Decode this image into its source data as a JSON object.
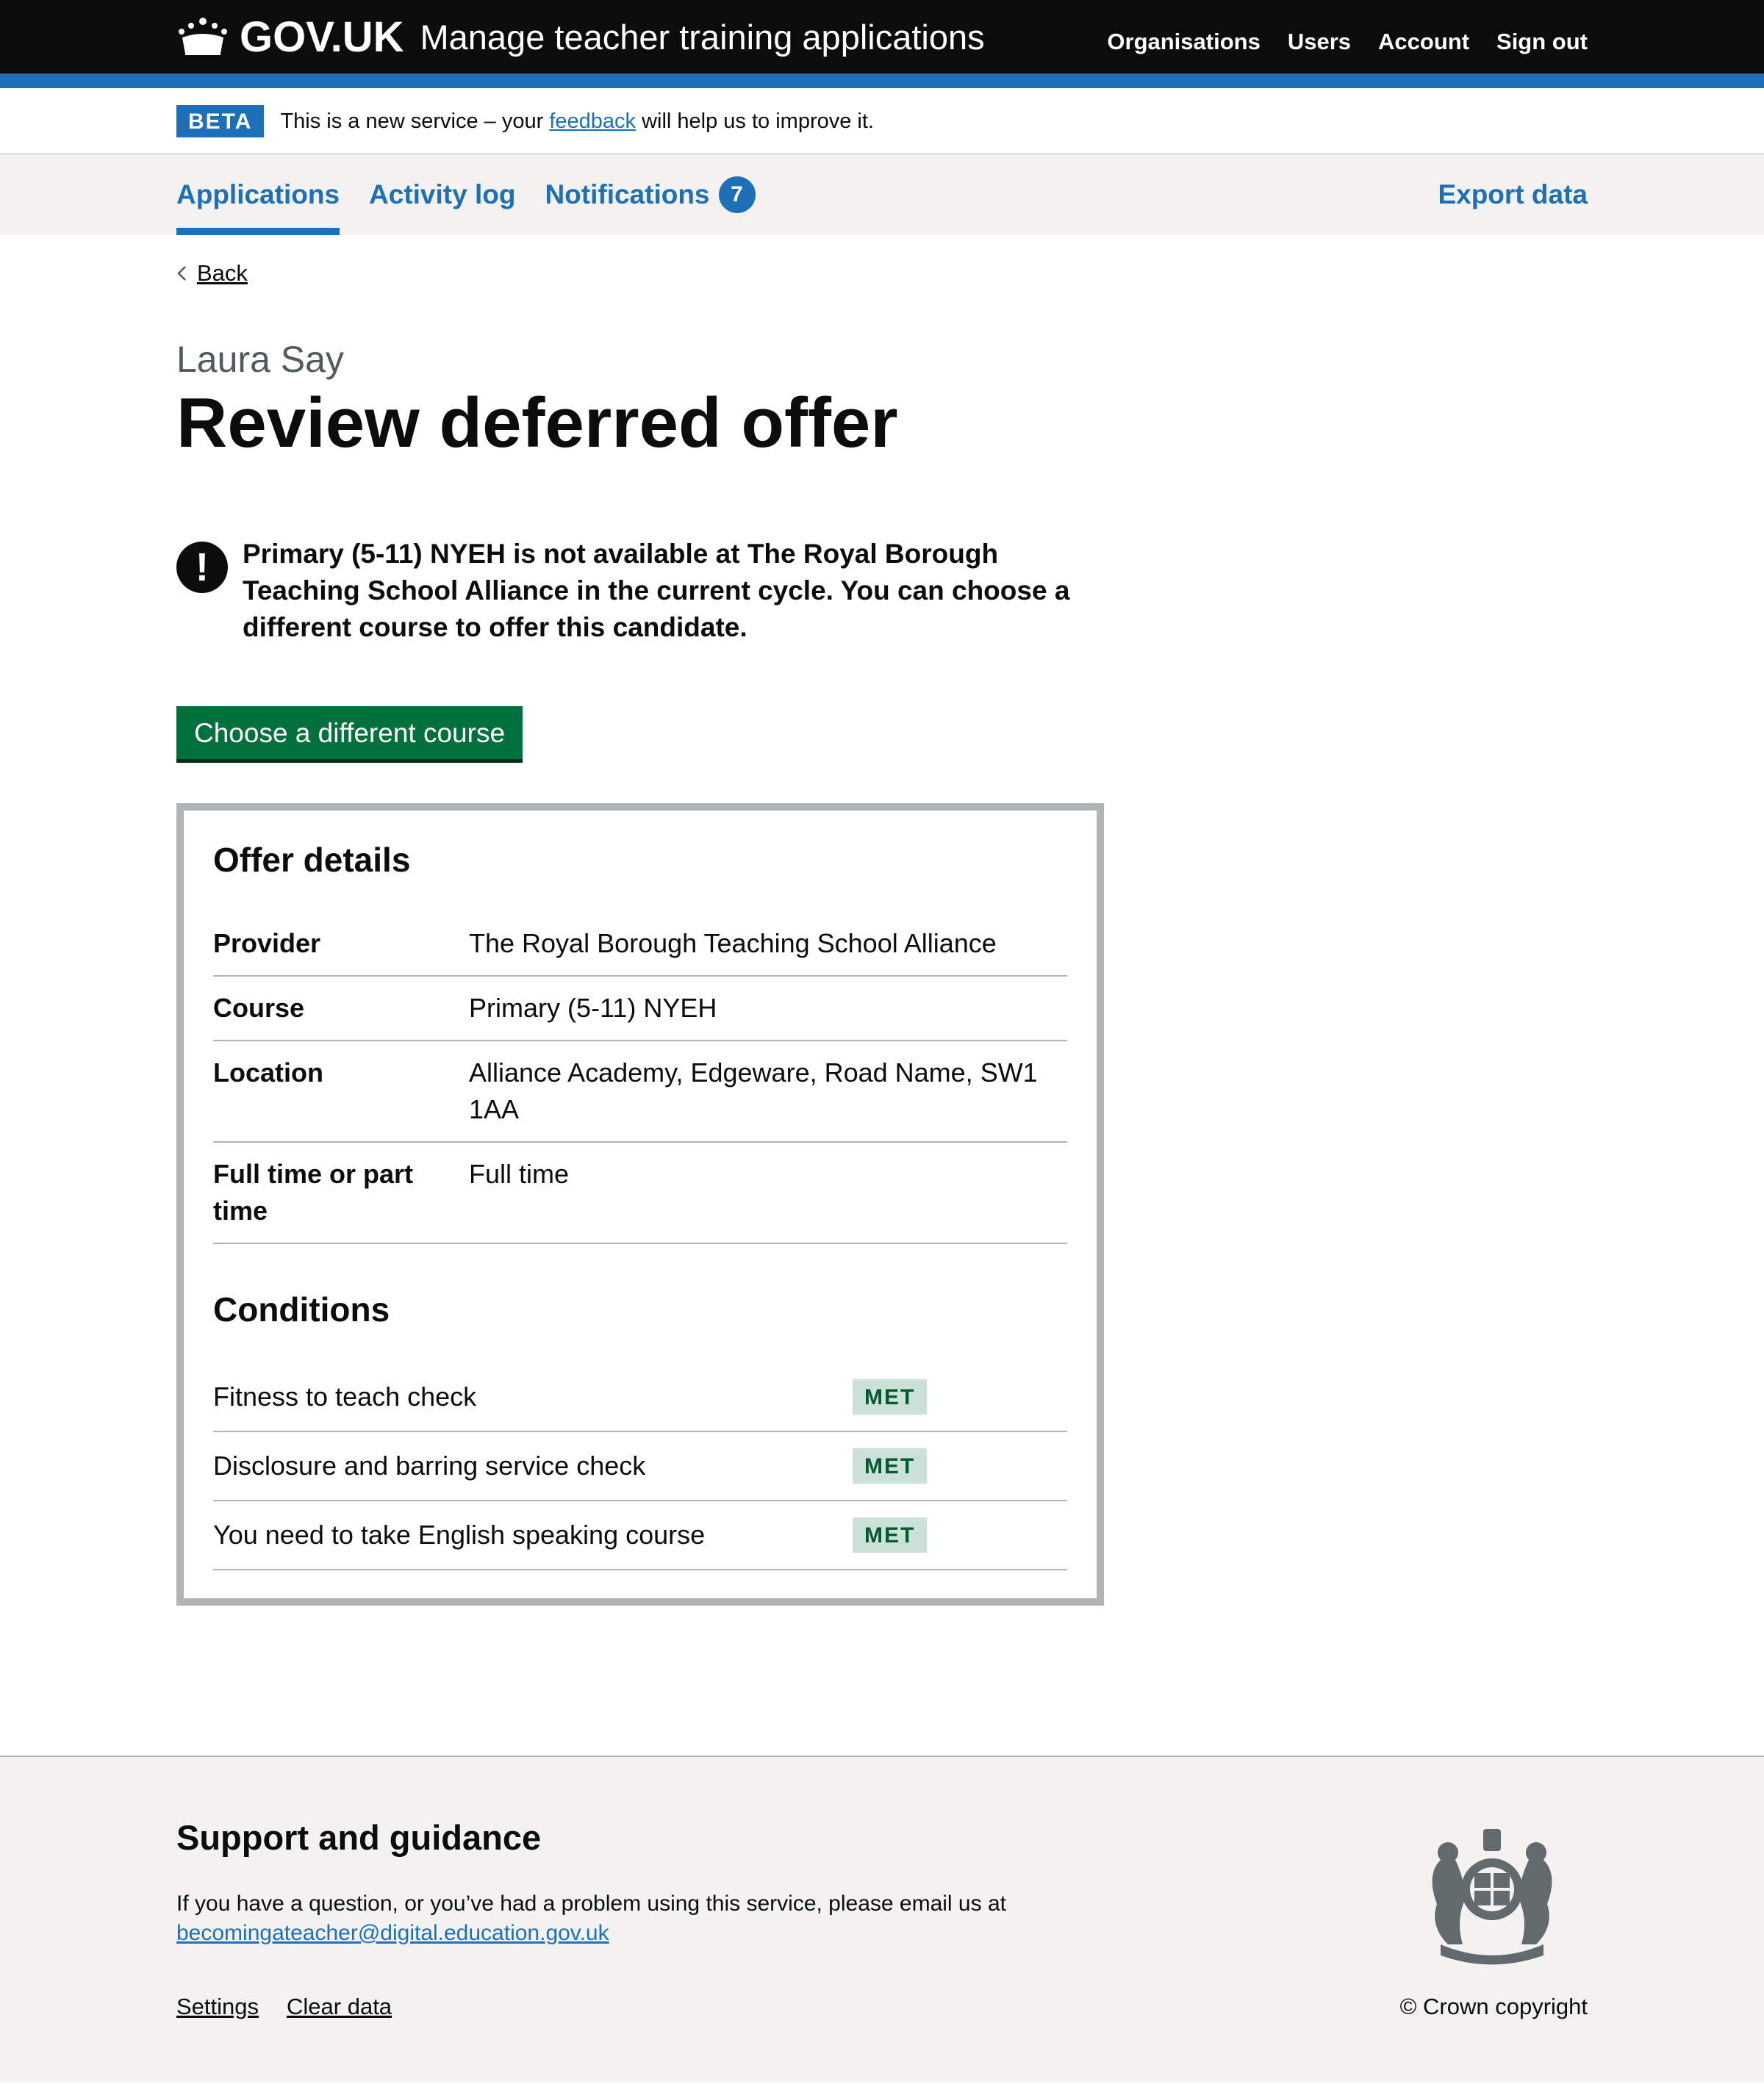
{
  "header": {
    "logo_text": "GOV.UK",
    "service_name": "Manage teacher training applications",
    "nav": [
      "Organisations",
      "Users",
      "Account",
      "Sign out"
    ]
  },
  "phase_banner": {
    "tag": "BETA",
    "text_before": "This is a new service – your",
    "link": "feedback",
    "text_after": "will help us to improve it."
  },
  "primary_nav": {
    "items": [
      {
        "label": "Applications",
        "current": true
      },
      {
        "label": "Activity log"
      },
      {
        "label": "Notifications",
        "badge": "7"
      }
    ],
    "export": "Export data"
  },
  "back_link": "Back",
  "page": {
    "caption": "Laura Say",
    "title": "Review deferred offer",
    "warning_icon": "!",
    "warning": "Primary (5-11) NYEH is not available at The Royal Borough Teaching School Alliance in the current cycle. You can choose a different course to offer this candidate.",
    "button": "Choose a different course"
  },
  "offer_details": {
    "title": "Offer details",
    "rows": [
      {
        "key": "Provider",
        "value": "The Royal Borough Teaching School Alliance"
      },
      {
        "key": "Course",
        "value": "Primary (5-11) NYEH"
      },
      {
        "key": "Location",
        "value": "Alliance Academy, Edgeware, Road Name, SW1 1AA"
      },
      {
        "key": "Full time or part time",
        "value": "Full time"
      }
    ]
  },
  "conditions": {
    "title": "Conditions",
    "items": [
      {
        "text": "Fitness to teach check",
        "status": "MET"
      },
      {
        "text": "Disclosure and barring service check",
        "status": "MET"
      },
      {
        "text": "You need to take English speaking course",
        "status": "MET"
      }
    ]
  },
  "footer": {
    "title": "Support and guidance",
    "text": "If you have a question, or you’ve had a problem using this service, please email us at",
    "email": "becomingateacher@digital.education.gov.uk",
    "links": [
      "Settings",
      "Clear data"
    ],
    "copyright": "© Crown copyright"
  },
  "colors": {
    "brand_blue": "#1d70b8",
    "header_black": "#0b0c0c",
    "button_green": "#00703c",
    "tag_met_bg": "#cce2d8",
    "tag_met_text": "#005a30"
  }
}
